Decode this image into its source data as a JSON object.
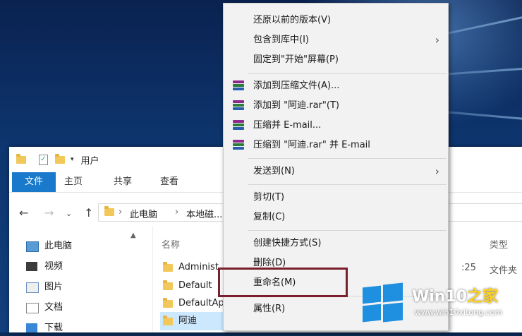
{
  "explorer": {
    "title": "用户",
    "ribbon_tabs": [
      "文件",
      "主页",
      "共享",
      "查看"
    ],
    "breadcrumb": [
      "此电脑",
      "本地磁..."
    ],
    "nav_items": [
      "此电脑",
      "视频",
      "图片",
      "文档",
      "下载"
    ],
    "columns": {
      "name": "名称",
      "type": "类型"
    },
    "rows": [
      "Administ",
      "Default",
      "DefaultAp",
      "阿迪"
    ],
    "row1_time": ":25",
    "row1_type": "文件夹"
  },
  "context_menu": {
    "items": [
      {
        "label": "还原以前的版本(V)"
      },
      {
        "label": "包含到库中(I)",
        "submenu": true
      },
      {
        "label": "固定到\"开始\"屏幕(P)"
      },
      {
        "label": "添加到压缩文件(A)...",
        "icon": "winrar-icon"
      },
      {
        "label": "添加到 \"阿迪.rar\"(T)",
        "icon": "winrar-icon"
      },
      {
        "label": "压缩并 E-mail...",
        "icon": "winrar-icon"
      },
      {
        "label": "压缩到 \"阿迪.rar\" 并 E-mail",
        "icon": "winrar-icon"
      },
      {
        "label": "发送到(N)",
        "submenu": true
      },
      {
        "label": "剪切(T)"
      },
      {
        "label": "复制(C)"
      },
      {
        "label": "创建快捷方式(S)"
      },
      {
        "label": "删除(D)"
      },
      {
        "label": "重命名(M)",
        "highlighted": true
      },
      {
        "label": "属性(R)"
      }
    ],
    "arrow_glyph": "›"
  },
  "watermark": {
    "title_main": "Win10",
    "title_accent": "之家",
    "url": "www.win10xitong.com"
  },
  "colors": {
    "ribbon_file_tab": "#1979ca",
    "highlight_box": "#7a1f2e",
    "brand_blue": "#1f8fe0",
    "brand_accent": "#ffd21f"
  }
}
